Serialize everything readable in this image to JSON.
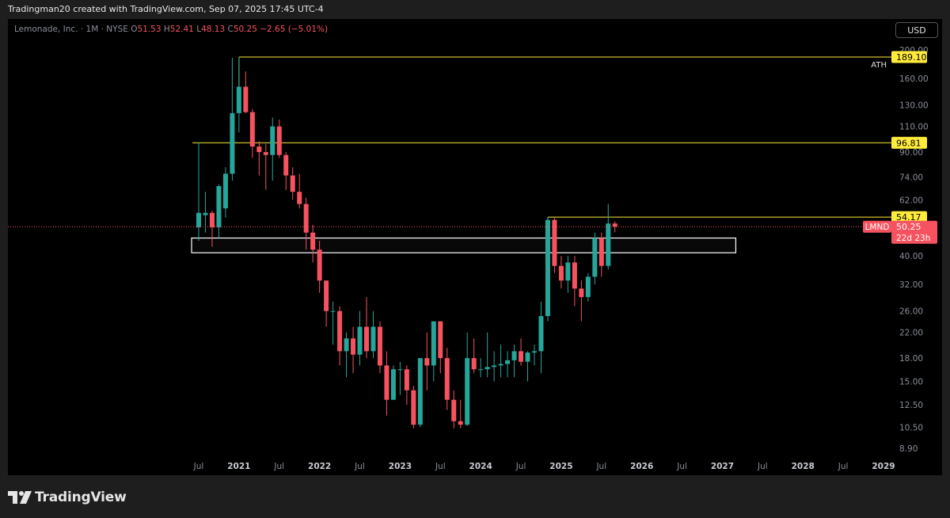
{
  "header": {
    "attribution": "Tradingman20 created with TradingView.com, Sep 07, 2025 17:45 UTC-4"
  },
  "legend": {
    "symbol": "Lemonade, Inc. · 1M · NYSE",
    "open_label": "O",
    "open": "51.53",
    "high_label": "H",
    "high": "52.41",
    "low_label": "L",
    "low": "48.13",
    "close_label": "C",
    "close": "50.25",
    "change": "−2.65 (−5.01%)"
  },
  "currency_button": "USD",
  "branding": {
    "logo_text": "TradingView"
  },
  "colors": {
    "up": "#26a69a",
    "down": "#f7525f",
    "level": "#ffeb3b",
    "zone": "#ffffff"
  },
  "chart_data": {
    "type": "candlestick",
    "scale": "log",
    "ylim": [
      8.5,
      210
    ],
    "y_ticks": [
      {
        "value": 200,
        "label": "200.00"
      },
      {
        "value": 160,
        "label": "160.00"
      },
      {
        "value": 130,
        "label": "130.00"
      },
      {
        "value": 110,
        "label": "110.00"
      },
      {
        "value": 90,
        "label": "90.00"
      },
      {
        "value": 74,
        "label": "74.00"
      },
      {
        "value": 62,
        "label": "62.00"
      },
      {
        "value": 40,
        "label": "40.00"
      },
      {
        "value": 32,
        "label": "32.00"
      },
      {
        "value": 26,
        "label": "26.00"
      },
      {
        "value": 22,
        "label": "22.00"
      },
      {
        "value": 18,
        "label": "18.00"
      },
      {
        "value": 15,
        "label": "15.00"
      },
      {
        "value": 12.5,
        "label": "12.50"
      },
      {
        "value": 10.5,
        "label": "10.50"
      },
      {
        "value": 8.9,
        "label": "8.90"
      }
    ],
    "x_ticks": [
      {
        "date": "2020-07",
        "label": "Jul",
        "bold": false
      },
      {
        "date": "2021-01",
        "label": "2021",
        "bold": true
      },
      {
        "date": "2021-07",
        "label": "Jul",
        "bold": false
      },
      {
        "date": "2022-01",
        "label": "2022",
        "bold": true
      },
      {
        "date": "2022-07",
        "label": "Jul",
        "bold": false
      },
      {
        "date": "2023-01",
        "label": "2023",
        "bold": true
      },
      {
        "date": "2023-07",
        "label": "Jul",
        "bold": false
      },
      {
        "date": "2024-01",
        "label": "2024",
        "bold": true
      },
      {
        "date": "2024-07",
        "label": "Jul",
        "bold": false
      },
      {
        "date": "2025-01",
        "label": "2025",
        "bold": true
      },
      {
        "date": "2025-07",
        "label": "Jul",
        "bold": false
      },
      {
        "date": "2026-01",
        "label": "2026",
        "bold": true
      },
      {
        "date": "2026-07",
        "label": "Jul",
        "bold": false
      },
      {
        "date": "2027-01",
        "label": "2027",
        "bold": true
      },
      {
        "date": "2027-07",
        "label": "Jul",
        "bold": false
      },
      {
        "date": "2028-01",
        "label": "2028",
        "bold": true
      },
      {
        "date": "2028-07",
        "label": "Jul",
        "bold": false
      },
      {
        "date": "2029-01",
        "label": "2029",
        "bold": true
      }
    ],
    "candles": [
      {
        "date": "2020-07",
        "o": 50,
        "h": 97,
        "l": 45,
        "c": 56
      },
      {
        "date": "2020-08",
        "o": 55,
        "h": 66,
        "l": 48,
        "c": 56
      },
      {
        "date": "2020-09",
        "o": 56,
        "h": 57,
        "l": 43,
        "c": 50
      },
      {
        "date": "2020-10",
        "o": 50,
        "h": 70,
        "l": 46,
        "c": 69
      },
      {
        "date": "2020-11",
        "o": 58,
        "h": 80,
        "l": 54,
        "c": 76
      },
      {
        "date": "2020-12",
        "o": 76,
        "h": 188,
        "l": 72,
        "c": 122
      },
      {
        "date": "2021-01",
        "o": 122,
        "h": 189.1,
        "l": 105,
        "c": 150
      },
      {
        "date": "2021-02",
        "o": 150,
        "h": 169,
        "l": 122,
        "c": 123
      },
      {
        "date": "2021-03",
        "o": 123,
        "h": 126,
        "l": 86,
        "c": 94
      },
      {
        "date": "2021-04",
        "o": 94,
        "h": 98,
        "l": 75,
        "c": 90
      },
      {
        "date": "2021-05",
        "o": 90,
        "h": 96,
        "l": 67,
        "c": 88
      },
      {
        "date": "2021-06",
        "o": 88,
        "h": 118,
        "l": 72,
        "c": 110
      },
      {
        "date": "2021-07",
        "o": 110,
        "h": 116,
        "l": 86,
        "c": 88
      },
      {
        "date": "2021-08",
        "o": 88,
        "h": 90,
        "l": 67,
        "c": 75
      },
      {
        "date": "2021-09",
        "o": 75,
        "h": 80,
        "l": 62,
        "c": 66
      },
      {
        "date": "2021-10",
        "o": 66,
        "h": 76,
        "l": 58,
        "c": 60
      },
      {
        "date": "2021-11",
        "o": 60,
        "h": 63,
        "l": 42,
        "c": 48
      },
      {
        "date": "2021-12",
        "o": 48,
        "h": 51,
        "l": 38,
        "c": 42
      },
      {
        "date": "2022-01",
        "o": 42,
        "h": 45,
        "l": 30,
        "c": 33
      },
      {
        "date": "2022-02",
        "o": 33,
        "h": 33,
        "l": 23,
        "c": 26
      },
      {
        "date": "2022-03",
        "o": 26,
        "h": 28,
        "l": 20,
        "c": 26
      },
      {
        "date": "2022-04",
        "o": 26,
        "h": 27,
        "l": 17,
        "c": 19
      },
      {
        "date": "2022-05",
        "o": 19,
        "h": 22,
        "l": 15.5,
        "c": 21
      },
      {
        "date": "2022-06",
        "o": 21,
        "h": 23,
        "l": 16,
        "c": 18.5
      },
      {
        "date": "2022-07",
        "o": 18.5,
        "h": 26,
        "l": 17,
        "c": 23
      },
      {
        "date": "2022-08",
        "o": 23,
        "h": 29,
        "l": 18,
        "c": 19
      },
      {
        "date": "2022-09",
        "o": 19,
        "h": 26,
        "l": 18,
        "c": 23
      },
      {
        "date": "2022-10",
        "o": 23,
        "h": 24,
        "l": 16,
        "c": 17
      },
      {
        "date": "2022-11",
        "o": 17,
        "h": 19,
        "l": 11.5,
        "c": 13
      },
      {
        "date": "2022-12",
        "o": 13,
        "h": 17,
        "l": 13,
        "c": 16.5
      },
      {
        "date": "2023-01",
        "o": 16.5,
        "h": 17.5,
        "l": 13.5,
        "c": 16.5
      },
      {
        "date": "2023-02",
        "o": 16.5,
        "h": 17,
        "l": 12.5,
        "c": 14
      },
      {
        "date": "2023-03",
        "o": 14,
        "h": 14.5,
        "l": 10.4,
        "c": 10.7
      },
      {
        "date": "2023-04",
        "o": 10.7,
        "h": 18,
        "l": 10.5,
        "c": 18
      },
      {
        "date": "2023-05",
        "o": 18,
        "h": 22,
        "l": 14,
        "c": 17
      },
      {
        "date": "2023-06",
        "o": 17,
        "h": 24,
        "l": 15,
        "c": 24
      },
      {
        "date": "2023-07",
        "o": 24,
        "h": 24,
        "l": 16,
        "c": 18
      },
      {
        "date": "2023-08",
        "o": 18,
        "h": 19.5,
        "l": 12,
        "c": 13
      },
      {
        "date": "2023-09",
        "o": 13,
        "h": 14,
        "l": 10.4,
        "c": 11
      },
      {
        "date": "2023-10",
        "o": 11,
        "h": 13,
        "l": 10.4,
        "c": 10.7
      },
      {
        "date": "2023-11",
        "o": 10.7,
        "h": 22,
        "l": 10.6,
        "c": 18
      },
      {
        "date": "2023-12",
        "o": 18,
        "h": 21,
        "l": 16,
        "c": 16.5
      },
      {
        "date": "2024-01",
        "o": 16.5,
        "h": 18,
        "l": 15.5,
        "c": 16.5
      },
      {
        "date": "2024-02",
        "o": 16.5,
        "h": 22,
        "l": 15.5,
        "c": 16.8
      },
      {
        "date": "2024-03",
        "o": 16.8,
        "h": 19,
        "l": 15,
        "c": 17
      },
      {
        "date": "2024-04",
        "o": 17,
        "h": 20,
        "l": 15.5,
        "c": 17.2
      },
      {
        "date": "2024-05",
        "o": 17.2,
        "h": 19,
        "l": 15.5,
        "c": 17.7
      },
      {
        "date": "2024-06",
        "o": 17.7,
        "h": 20,
        "l": 15.5,
        "c": 19
      },
      {
        "date": "2024-07",
        "o": 19,
        "h": 21,
        "l": 17,
        "c": 17.5
      },
      {
        "date": "2024-08",
        "o": 17.5,
        "h": 19,
        "l": 15,
        "c": 18.8
      },
      {
        "date": "2024-09",
        "o": 18.8,
        "h": 20,
        "l": 17,
        "c": 19
      },
      {
        "date": "2024-10",
        "o": 19,
        "h": 28,
        "l": 16,
        "c": 25
      },
      {
        "date": "2024-11",
        "o": 25,
        "h": 54.17,
        "l": 24,
        "c": 53
      },
      {
        "date": "2024-12",
        "o": 53,
        "h": 54.17,
        "l": 35,
        "c": 37
      },
      {
        "date": "2025-01",
        "o": 37,
        "h": 40,
        "l": 31,
        "c": 33
      },
      {
        "date": "2025-02",
        "o": 33,
        "h": 40,
        "l": 30,
        "c": 38
      },
      {
        "date": "2025-03",
        "o": 38,
        "h": 40,
        "l": 27,
        "c": 31
      },
      {
        "date": "2025-04",
        "o": 31,
        "h": 33,
        "l": 24,
        "c": 29
      },
      {
        "date": "2025-05",
        "o": 29,
        "h": 35,
        "l": 28,
        "c": 34
      },
      {
        "date": "2025-06",
        "o": 34,
        "h": 48,
        "l": 32,
        "c": 46
      },
      {
        "date": "2025-07",
        "o": 46,
        "h": 48,
        "l": 34,
        "c": 37
      },
      {
        "date": "2025-08",
        "o": 37,
        "h": 60,
        "l": 36,
        "c": 51.53
      },
      {
        "date": "2025-09",
        "o": 51.53,
        "h": 52.41,
        "l": 48.13,
        "c": 50.25
      }
    ],
    "levels": [
      {
        "price": 189.1,
        "label": "189.10",
        "note": "ATH",
        "from": "2021-01"
      },
      {
        "price": 96.81,
        "label": "96.81",
        "from": "2020-07"
      },
      {
        "price": 54.17,
        "label": "54.17",
        "from": "2024-11"
      }
    ],
    "zone": {
      "from": "2020-07",
      "to": "2027-01",
      "top": 46,
      "bottom": 41
    },
    "last_price": {
      "value": 50.25,
      "label": "50.25",
      "ticker": "LMND",
      "countdown": "22d 23h"
    }
  }
}
